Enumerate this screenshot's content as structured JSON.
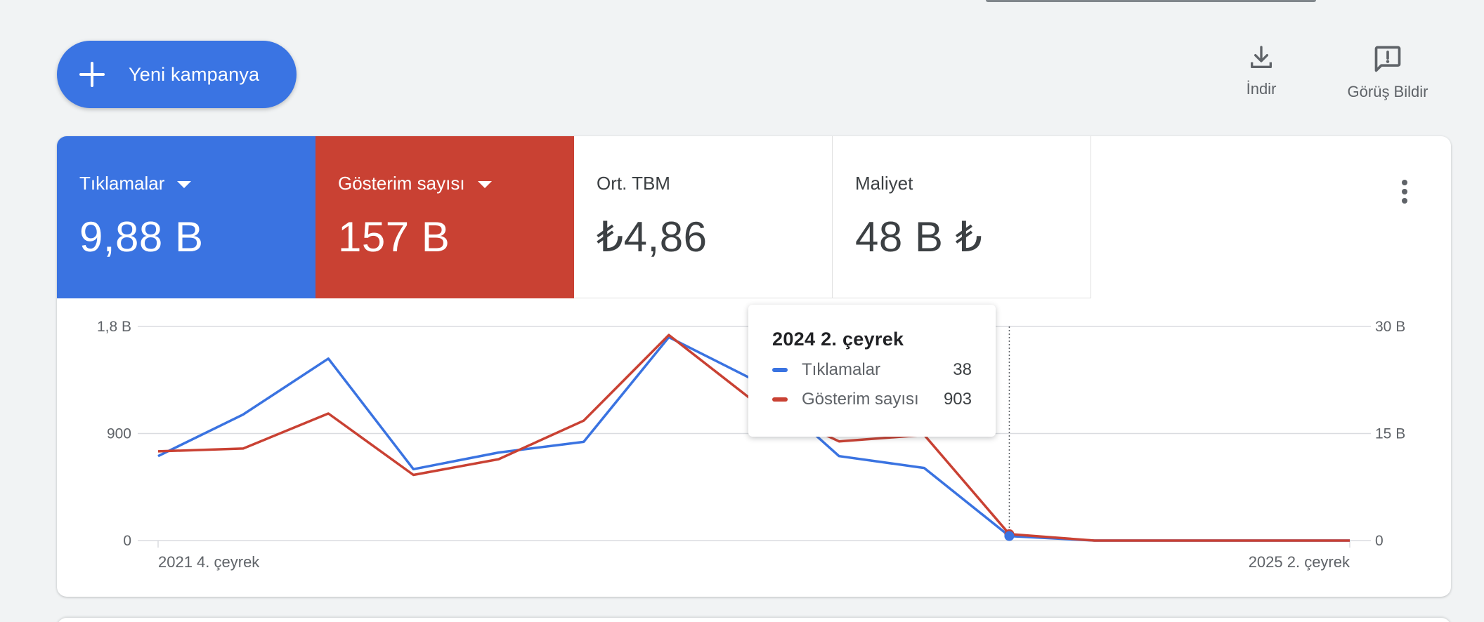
{
  "header": {
    "new_campaign_label": "Yeni kampanya",
    "download_label": "İndir",
    "feedback_label": "Görüş Bildir"
  },
  "metrics": {
    "clicks": {
      "name": "Tıklamalar",
      "value": "9,88 B",
      "color": "#3a73e1"
    },
    "impressions": {
      "name": "Gösterim sayısı",
      "value": "157 B",
      "color": "#c94133"
    },
    "avg_cpc": {
      "name": "Ort. TBM",
      "value": "₺4,86"
    },
    "cost": {
      "name": "Maliyet",
      "value": "48 B ₺"
    }
  },
  "icons": {
    "new_campaign": "plus-icon",
    "download": "download-icon",
    "feedback": "feedback-icon",
    "more": "more-vert-icon"
  },
  "tooltip": {
    "title": "2024 2. çeyrek",
    "rows": [
      {
        "name": "Tıklamalar",
        "value": "38",
        "color": "#3a73e1"
      },
      {
        "name": "Gösterim sayısı",
        "value": "903",
        "color": "#c94133"
      }
    ]
  },
  "chart_data": {
    "type": "line",
    "x_tick_labels": [
      "2021 4. çeyrek",
      "2025 2. çeyrek"
    ],
    "y_left": {
      "ticks": [
        0,
        900,
        1800
      ],
      "tick_labels": [
        "0",
        "900",
        "1,8 B"
      ],
      "ylim": [
        0,
        1800
      ]
    },
    "y_right": {
      "ticks": [
        0,
        15000,
        30000
      ],
      "tick_labels": [
        "0",
        "15 B",
        "30 B"
      ],
      "ylim": [
        0,
        30000
      ]
    },
    "grid": true,
    "highlight_index": 10,
    "series": [
      {
        "name": "Tıklamalar",
        "axis": "left",
        "color": "#3a73e1",
        "values": [
          710,
          1060,
          1530,
          600,
          740,
          830,
          1710,
          1350,
          710,
          610,
          38,
          0,
          0,
          0,
          0
        ]
      },
      {
        "name": "Gösterim sayısı",
        "axis": "right",
        "color": "#c94133",
        "values": [
          12500,
          12900,
          17800,
          9200,
          11400,
          16800,
          28800,
          19500,
          13900,
          14800,
          903,
          0,
          0,
          0,
          0
        ]
      }
    ]
  }
}
